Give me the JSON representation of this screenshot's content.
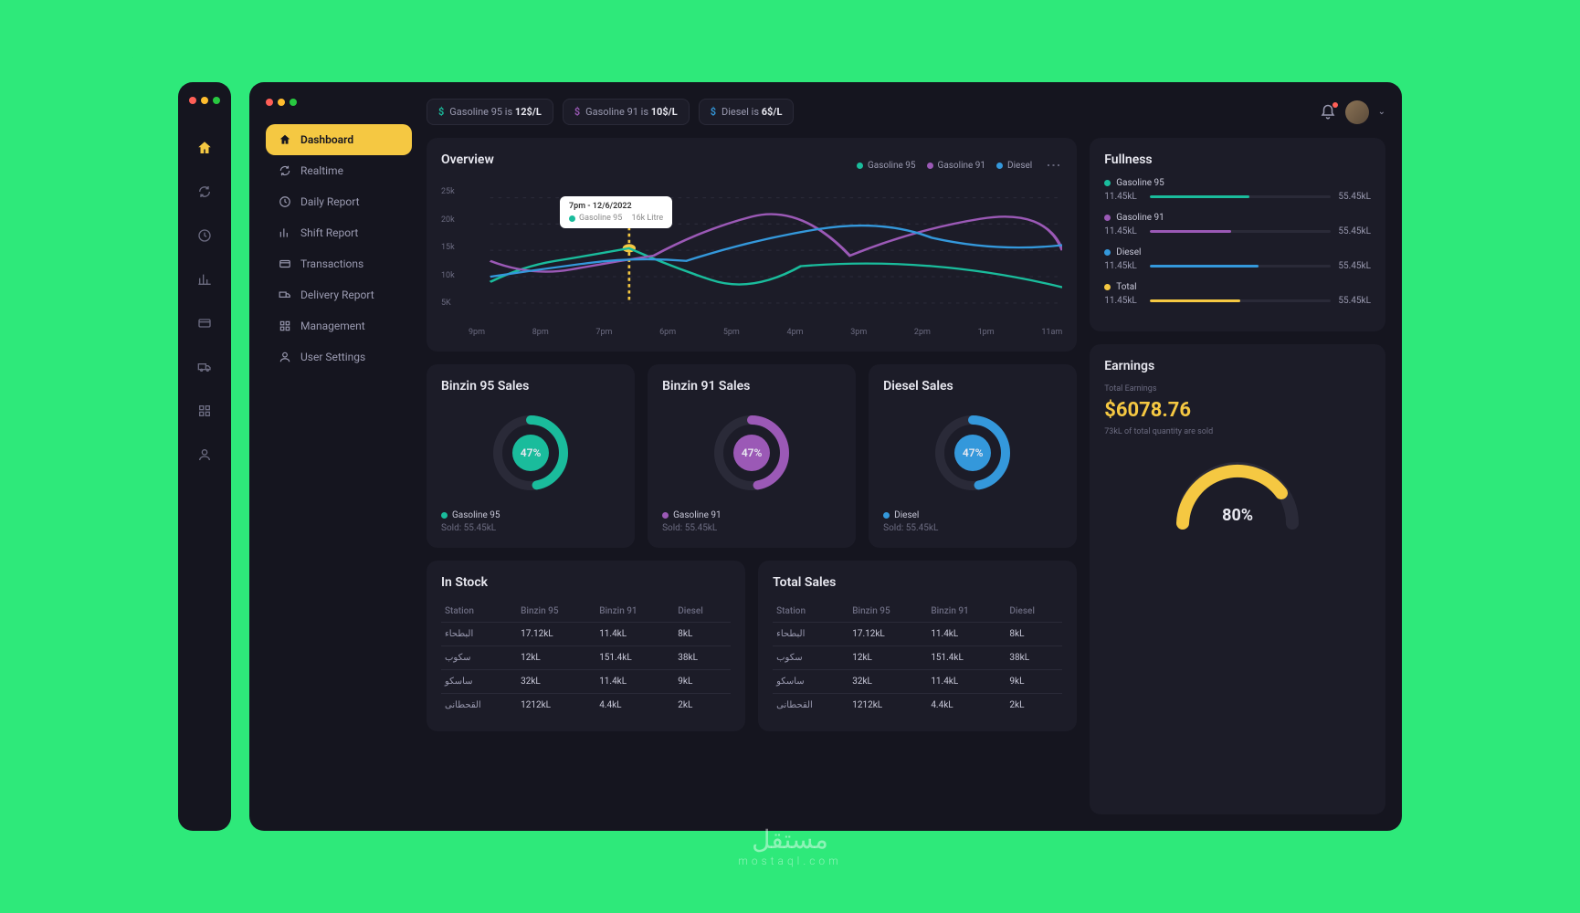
{
  "sidebar": {
    "items": [
      {
        "label": "Dashboard",
        "icon": "home",
        "active": true
      },
      {
        "label": "Realtime",
        "icon": "refresh"
      },
      {
        "label": "Daily Report",
        "icon": "clock"
      },
      {
        "label": "Shift Report",
        "icon": "chart"
      },
      {
        "label": "Transactions",
        "icon": "card"
      },
      {
        "label": "Delivery Report",
        "icon": "truck"
      },
      {
        "label": "Management",
        "icon": "grid"
      },
      {
        "label": "User Settings",
        "icon": "user"
      }
    ]
  },
  "topbar": {
    "chips": [
      {
        "prefix": "Gasoline 95 is",
        "value": "12$/L",
        "color": "#1ABC9C"
      },
      {
        "prefix": "Gasoline 91 is",
        "value": "10$/L",
        "color": "#9B59B6"
      },
      {
        "prefix": "Diesel is",
        "value": "6$/L",
        "color": "#3498DB"
      }
    ]
  },
  "overview": {
    "title": "Overview",
    "legend": [
      {
        "label": "Gasoline 95",
        "color": "teal"
      },
      {
        "label": "Gasoline 91",
        "color": "purple"
      },
      {
        "label": "Diesel",
        "color": "blue"
      }
    ],
    "y_ticks": [
      "25k",
      "20k",
      "15k",
      "10k",
      "5K"
    ],
    "x_ticks": [
      "9pm",
      "8pm",
      "7pm",
      "6pm",
      "5pm",
      "4pm",
      "3pm",
      "2pm",
      "1pm",
      "11am"
    ],
    "tooltip": {
      "title": "7pm - 12/6/2022",
      "series": "Gasoline 95",
      "value": "16k Litre"
    }
  },
  "sales": [
    {
      "title": "Binzin 95 Sales",
      "pct": "47%",
      "color": "#1ABC9C",
      "label": "Gasoline 95",
      "sold": "Sold: 55.45kL"
    },
    {
      "title": "Binzin 91 Sales",
      "pct": "47%",
      "color": "#9B59B6",
      "label": "Gasoline 91",
      "sold": "Sold: 55.45kL"
    },
    {
      "title": "Diesel Sales",
      "pct": "47%",
      "color": "#3498DB",
      "label": "Diesel",
      "sold": "Sold: 55.45kL"
    }
  ],
  "fullness": {
    "title": "Fullness",
    "items": [
      {
        "label": "Gasoline 95",
        "val": "11.45kL",
        "max": "55.45kL",
        "fill": 55,
        "color": "#1ABC9C"
      },
      {
        "label": "Gasoline 91",
        "val": "11.45kL",
        "max": "55.45kL",
        "fill": 45,
        "color": "#9B59B6"
      },
      {
        "label": "Diesel",
        "val": "11.45kL",
        "max": "55.45kL",
        "fill": 60,
        "color": "#3498DB"
      },
      {
        "label": "Total",
        "val": "11.45kL",
        "max": "55.45kL",
        "fill": 50,
        "color": "#F5C842"
      }
    ]
  },
  "earnings": {
    "title": "Earnings",
    "sub": "Total Earnings",
    "amount": "$6078.76",
    "note": "73kL of total quantity are sold",
    "pct": "80%"
  },
  "stock": {
    "title": "In Stock",
    "headers": [
      "Station",
      "Binzin 95",
      "Binzin 91",
      "Diesel"
    ],
    "rows": [
      [
        "البطحاء",
        "17.12kL",
        "11.4kL",
        "8kL"
      ],
      [
        "سكوب",
        "12kL",
        "151.4kL",
        "38kL"
      ],
      [
        "ساسكو",
        "32kL",
        "11.4kL",
        "9kL"
      ],
      [
        "القحطانى",
        "1212kL",
        "4.4kL",
        "2kL"
      ]
    ]
  },
  "totalSales": {
    "title": "Total Sales",
    "headers": [
      "Station",
      "Binzin 95",
      "Binzin 91",
      "Diesel"
    ],
    "rows": [
      [
        "البطحاء",
        "17.12kL",
        "11.4kL",
        "8kL"
      ],
      [
        "سكوب",
        "12kL",
        "151.4kL",
        "38kL"
      ],
      [
        "ساسكو",
        "32kL",
        "11.4kL",
        "9kL"
      ],
      [
        "القحطانى",
        "1212kL",
        "4.4kL",
        "2kL"
      ]
    ]
  },
  "watermark": {
    "ar": "مستقل",
    "en": "mostaql.com"
  },
  "chart_data": {
    "type": "line",
    "title": "Overview",
    "xlabel": "",
    "ylabel": "",
    "ylim": [
      5000,
      25000
    ],
    "categories": [
      "9pm",
      "8pm",
      "7pm",
      "6pm",
      "5pm",
      "4pm",
      "3pm",
      "2pm",
      "1pm",
      "11am"
    ],
    "series": [
      {
        "name": "Gasoline 95",
        "color": "#1ABC9C",
        "values": [
          8000,
          12000,
          16000,
          13000,
          10000,
          12000,
          11000,
          13000,
          11000,
          9000
        ]
      },
      {
        "name": "Gasoline 91",
        "color": "#9B59B6",
        "values": [
          12000,
          10000,
          11000,
          15000,
          20000,
          14000,
          18000,
          13000,
          19000,
          14000
        ]
      },
      {
        "name": "Diesel",
        "color": "#3498DB",
        "values": [
          10000,
          11000,
          13000,
          12000,
          15000,
          18000,
          16000,
          17000,
          14000,
          15000
        ]
      }
    ]
  }
}
